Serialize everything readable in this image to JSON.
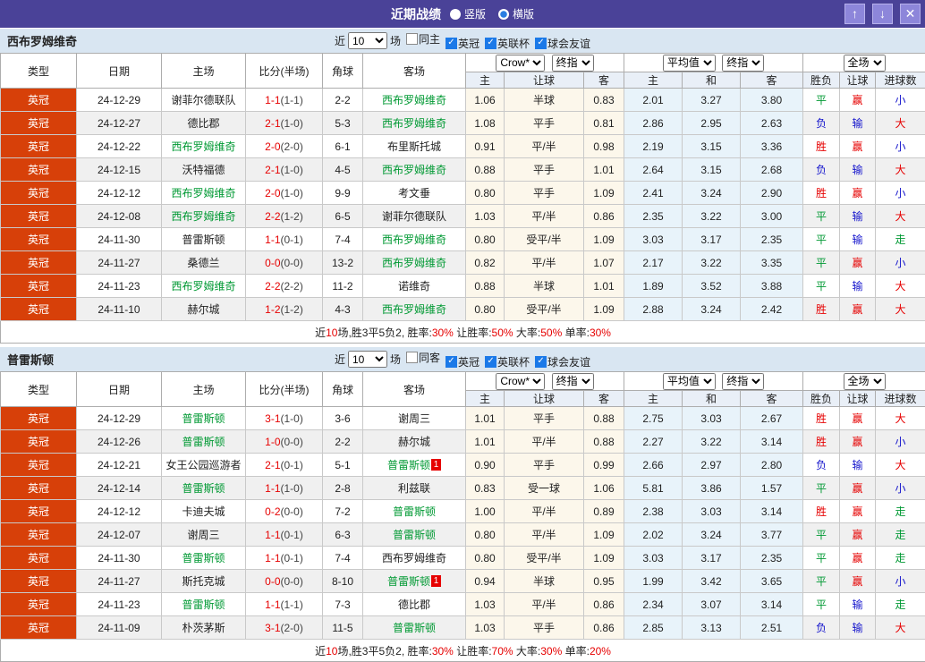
{
  "colors": {
    "titlebar_bg": "#4a4298",
    "section_header_bg": "#d9e6f2",
    "league_badge_bg": "#d74009",
    "win_red": "#e60000",
    "lose_blue": "#1414cc",
    "draw_green": "#009933",
    "team_highlight_green": "#009933",
    "asian_odds_bg": "#fcf7eb",
    "euro_odds_bg": "#e8f3fa"
  },
  "titlebar": {
    "title": "近期战绩",
    "radios": [
      {
        "label": "竖版",
        "state": "off"
      },
      {
        "label": "横版",
        "state": "on"
      }
    ],
    "up_button": "↑",
    "down_button": "↓",
    "close_button": "✕"
  },
  "table_header": {
    "left_columns": [
      "类型",
      "日期",
      "主场",
      "比分(半场)",
      "角球",
      "客场"
    ],
    "group1_selects": [
      "Crow*",
      "终指"
    ],
    "group2_selects": [
      "平均值",
      "终指"
    ],
    "group3_selects": [
      "全场"
    ],
    "sub_columns": [
      "主",
      "让球",
      "客",
      "主",
      "和",
      "客",
      "胜负",
      "让球",
      "进球数"
    ]
  },
  "sections": [
    {
      "team": "西布罗姆维奇",
      "filters": {
        "prefix": "近",
        "count": "10",
        "suffix": "场",
        "checks": [
          {
            "label": "同主",
            "state": "off"
          },
          {
            "label": "英冠",
            "state": "on"
          },
          {
            "label": "英联杯",
            "state": "on"
          },
          {
            "label": "球会友谊",
            "state": "on"
          }
        ]
      },
      "rows": [
        {
          "league": "英冠",
          "date": "24-12-29",
          "home": {
            "t": "谢菲尔德联队",
            "c": "k"
          },
          "ft": "1-1",
          "ht": "(1-1)",
          "corner": "2-2",
          "away": {
            "t": "西布罗姆维奇",
            "c": "g"
          },
          "badge": "",
          "ah": [
            "1.06",
            "半球",
            "0.83"
          ],
          "eu": [
            "2.01",
            "3.27",
            "3.80"
          ],
          "res": [
            {
              "t": "平",
              "c": "g"
            },
            {
              "t": "赢",
              "c": "r"
            },
            {
              "t": "小",
              "c": "b"
            }
          ]
        },
        {
          "league": "英冠",
          "date": "24-12-27",
          "home": {
            "t": "德比郡",
            "c": "k"
          },
          "ft": "2-1",
          "ht": "(1-0)",
          "corner": "5-3",
          "away": {
            "t": "西布罗姆维奇",
            "c": "g"
          },
          "badge": "",
          "ah": [
            "1.08",
            "平手",
            "0.81"
          ],
          "eu": [
            "2.86",
            "2.95",
            "2.63"
          ],
          "res": [
            {
              "t": "负",
              "c": "b"
            },
            {
              "t": "输",
              "c": "b"
            },
            {
              "t": "大",
              "c": "r"
            }
          ]
        },
        {
          "league": "英冠",
          "date": "24-12-22",
          "home": {
            "t": "西布罗姆维奇",
            "c": "g"
          },
          "ft": "2-0",
          "ht": "(2-0)",
          "corner": "6-1",
          "away": {
            "t": "布里斯托城",
            "c": "k"
          },
          "badge": "",
          "ah": [
            "0.91",
            "平/半",
            "0.98"
          ],
          "eu": [
            "2.19",
            "3.15",
            "3.36"
          ],
          "res": [
            {
              "t": "胜",
              "c": "r"
            },
            {
              "t": "赢",
              "c": "r"
            },
            {
              "t": "小",
              "c": "b"
            }
          ]
        },
        {
          "league": "英冠",
          "date": "24-12-15",
          "home": {
            "t": "沃特福德",
            "c": "k"
          },
          "ft": "2-1",
          "ht": "(1-0)",
          "corner": "4-5",
          "away": {
            "t": "西布罗姆维奇",
            "c": "g"
          },
          "badge": "",
          "ah": [
            "0.88",
            "平手",
            "1.01"
          ],
          "eu": [
            "2.64",
            "3.15",
            "2.68"
          ],
          "res": [
            {
              "t": "负",
              "c": "b"
            },
            {
              "t": "输",
              "c": "b"
            },
            {
              "t": "大",
              "c": "r"
            }
          ]
        },
        {
          "league": "英冠",
          "date": "24-12-12",
          "home": {
            "t": "西布罗姆维奇",
            "c": "g"
          },
          "ft": "2-0",
          "ht": "(1-0)",
          "corner": "9-9",
          "away": {
            "t": "考文垂",
            "c": "k"
          },
          "badge": "",
          "ah": [
            "0.80",
            "平手",
            "1.09"
          ],
          "eu": [
            "2.41",
            "3.24",
            "2.90"
          ],
          "res": [
            {
              "t": "胜",
              "c": "r"
            },
            {
              "t": "赢",
              "c": "r"
            },
            {
              "t": "小",
              "c": "b"
            }
          ]
        },
        {
          "league": "英冠",
          "date": "24-12-08",
          "home": {
            "t": "西布罗姆维奇",
            "c": "g"
          },
          "ft": "2-2",
          "ht": "(1-2)",
          "corner": "6-5",
          "away": {
            "t": "谢菲尔德联队",
            "c": "k"
          },
          "badge": "",
          "ah": [
            "1.03",
            "平/半",
            "0.86"
          ],
          "eu": [
            "2.35",
            "3.22",
            "3.00"
          ],
          "res": [
            {
              "t": "平",
              "c": "g"
            },
            {
              "t": "输",
              "c": "b"
            },
            {
              "t": "大",
              "c": "r"
            }
          ]
        },
        {
          "league": "英冠",
          "date": "24-11-30",
          "home": {
            "t": "普雷斯顿",
            "c": "k"
          },
          "ft": "1-1",
          "ht": "(0-1)",
          "corner": "7-4",
          "away": {
            "t": "西布罗姆维奇",
            "c": "g"
          },
          "badge": "",
          "ah": [
            "0.80",
            "受平/半",
            "1.09"
          ],
          "eu": [
            "3.03",
            "3.17",
            "2.35"
          ],
          "res": [
            {
              "t": "平",
              "c": "g"
            },
            {
              "t": "输",
              "c": "b"
            },
            {
              "t": "走",
              "c": "g"
            }
          ]
        },
        {
          "league": "英冠",
          "date": "24-11-27",
          "home": {
            "t": "桑德兰",
            "c": "k"
          },
          "ft": "0-0",
          "ht": "(0-0)",
          "corner": "13-2",
          "away": {
            "t": "西布罗姆维奇",
            "c": "g"
          },
          "badge": "",
          "ah": [
            "0.82",
            "平/半",
            "1.07"
          ],
          "eu": [
            "2.17",
            "3.22",
            "3.35"
          ],
          "res": [
            {
              "t": "平",
              "c": "g"
            },
            {
              "t": "赢",
              "c": "r"
            },
            {
              "t": "小",
              "c": "b"
            }
          ]
        },
        {
          "league": "英冠",
          "date": "24-11-23",
          "home": {
            "t": "西布罗姆维奇",
            "c": "g"
          },
          "ft": "2-2",
          "ht": "(2-2)",
          "corner": "11-2",
          "away": {
            "t": "诺维奇",
            "c": "k"
          },
          "badge": "",
          "ah": [
            "0.88",
            "半球",
            "1.01"
          ],
          "eu": [
            "1.89",
            "3.52",
            "3.88"
          ],
          "res": [
            {
              "t": "平",
              "c": "g"
            },
            {
              "t": "输",
              "c": "b"
            },
            {
              "t": "大",
              "c": "r"
            }
          ]
        },
        {
          "league": "英冠",
          "date": "24-11-10",
          "home": {
            "t": "赫尔城",
            "c": "k"
          },
          "ft": "1-2",
          "ht": "(1-2)",
          "corner": "4-3",
          "away": {
            "t": "西布罗姆维奇",
            "c": "g"
          },
          "badge": "",
          "ah": [
            "0.80",
            "受平/半",
            "1.09"
          ],
          "eu": [
            "2.88",
            "3.24",
            "2.42"
          ],
          "res": [
            {
              "t": "胜",
              "c": "r"
            },
            {
              "t": "赢",
              "c": "r"
            },
            {
              "t": "大",
              "c": "r"
            }
          ]
        }
      ],
      "summary": [
        {
          "t": "近",
          "c": "k"
        },
        {
          "t": "10",
          "c": "r"
        },
        {
          "t": "场,胜3平5负2, 胜率:",
          "c": "k"
        },
        {
          "t": "30%",
          "c": "r"
        },
        {
          "t": " 让胜率:",
          "c": "k"
        },
        {
          "t": "50%",
          "c": "r"
        },
        {
          "t": " 大率:",
          "c": "k"
        },
        {
          "t": "50%",
          "c": "r"
        },
        {
          "t": " 单率:",
          "c": "k"
        },
        {
          "t": "30%",
          "c": "r"
        }
      ]
    },
    {
      "team": "普雷斯顿",
      "filters": {
        "prefix": "近",
        "count": "10",
        "suffix": "场",
        "checks": [
          {
            "label": "同客",
            "state": "off"
          },
          {
            "label": "英冠",
            "state": "on"
          },
          {
            "label": "英联杯",
            "state": "on"
          },
          {
            "label": "球会友谊",
            "state": "on"
          }
        ]
      },
      "rows": [
        {
          "league": "英冠",
          "date": "24-12-29",
          "home": {
            "t": "普雷斯顿",
            "c": "g"
          },
          "ft": "3-1",
          "ht": "(1-0)",
          "corner": "3-6",
          "away": {
            "t": "谢周三",
            "c": "k"
          },
          "badge": "",
          "ah": [
            "1.01",
            "平手",
            "0.88"
          ],
          "eu": [
            "2.75",
            "3.03",
            "2.67"
          ],
          "res": [
            {
              "t": "胜",
              "c": "r"
            },
            {
              "t": "赢",
              "c": "r"
            },
            {
              "t": "大",
              "c": "r"
            }
          ]
        },
        {
          "league": "英冠",
          "date": "24-12-26",
          "home": {
            "t": "普雷斯顿",
            "c": "g"
          },
          "ft": "1-0",
          "ht": "(0-0)",
          "corner": "2-2",
          "away": {
            "t": "赫尔城",
            "c": "k"
          },
          "badge": "",
          "ah": [
            "1.01",
            "平/半",
            "0.88"
          ],
          "eu": [
            "2.27",
            "3.22",
            "3.14"
          ],
          "res": [
            {
              "t": "胜",
              "c": "r"
            },
            {
              "t": "赢",
              "c": "r"
            },
            {
              "t": "小",
              "c": "b"
            }
          ]
        },
        {
          "league": "英冠",
          "date": "24-12-21",
          "home": {
            "t": "女王公园巡游者",
            "c": "k"
          },
          "ft": "2-1",
          "ht": "(0-1)",
          "corner": "5-1",
          "away": {
            "t": "普雷斯顿",
            "c": "g"
          },
          "badge": "1",
          "ah": [
            "0.90",
            "平手",
            "0.99"
          ],
          "eu": [
            "2.66",
            "2.97",
            "2.80"
          ],
          "res": [
            {
              "t": "负",
              "c": "b"
            },
            {
              "t": "输",
              "c": "b"
            },
            {
              "t": "大",
              "c": "r"
            }
          ]
        },
        {
          "league": "英冠",
          "date": "24-12-14",
          "home": {
            "t": "普雷斯顿",
            "c": "g"
          },
          "ft": "1-1",
          "ht": "(1-0)",
          "corner": "2-8",
          "away": {
            "t": "利兹联",
            "c": "k"
          },
          "badge": "",
          "ah": [
            "0.83",
            "受一球",
            "1.06"
          ],
          "eu": [
            "5.81",
            "3.86",
            "1.57"
          ],
          "res": [
            {
              "t": "平",
              "c": "g"
            },
            {
              "t": "赢",
              "c": "r"
            },
            {
              "t": "小",
              "c": "b"
            }
          ]
        },
        {
          "league": "英冠",
          "date": "24-12-12",
          "home": {
            "t": "卡迪夫城",
            "c": "k"
          },
          "ft": "0-2",
          "ht": "(0-0)",
          "corner": "7-2",
          "away": {
            "t": "普雷斯顿",
            "c": "g"
          },
          "badge": "",
          "ah": [
            "1.00",
            "平/半",
            "0.89"
          ],
          "eu": [
            "2.38",
            "3.03",
            "3.14"
          ],
          "res": [
            {
              "t": "胜",
              "c": "r"
            },
            {
              "t": "赢",
              "c": "r"
            },
            {
              "t": "走",
              "c": "g"
            }
          ]
        },
        {
          "league": "英冠",
          "date": "24-12-07",
          "home": {
            "t": "谢周三",
            "c": "k"
          },
          "ft": "1-1",
          "ht": "(0-1)",
          "corner": "6-3",
          "away": {
            "t": "普雷斯顿",
            "c": "g"
          },
          "badge": "",
          "ah": [
            "0.80",
            "平/半",
            "1.09"
          ],
          "eu": [
            "2.02",
            "3.24",
            "3.77"
          ],
          "res": [
            {
              "t": "平",
              "c": "g"
            },
            {
              "t": "赢",
              "c": "r"
            },
            {
              "t": "走",
              "c": "g"
            }
          ]
        },
        {
          "league": "英冠",
          "date": "24-11-30",
          "home": {
            "t": "普雷斯顿",
            "c": "g"
          },
          "ft": "1-1",
          "ht": "(0-1)",
          "corner": "7-4",
          "away": {
            "t": "西布罗姆维奇",
            "c": "k"
          },
          "badge": "",
          "ah": [
            "0.80",
            "受平/半",
            "1.09"
          ],
          "eu": [
            "3.03",
            "3.17",
            "2.35"
          ],
          "res": [
            {
              "t": "平",
              "c": "g"
            },
            {
              "t": "赢",
              "c": "r"
            },
            {
              "t": "走",
              "c": "g"
            }
          ]
        },
        {
          "league": "英冠",
          "date": "24-11-27",
          "home": {
            "t": "斯托克城",
            "c": "k"
          },
          "ft": "0-0",
          "ht": "(0-0)",
          "corner": "8-10",
          "away": {
            "t": "普雷斯顿",
            "c": "g"
          },
          "badge": "1",
          "ah": [
            "0.94",
            "半球",
            "0.95"
          ],
          "eu": [
            "1.99",
            "3.42",
            "3.65"
          ],
          "res": [
            {
              "t": "平",
              "c": "g"
            },
            {
              "t": "赢",
              "c": "r"
            },
            {
              "t": "小",
              "c": "b"
            }
          ]
        },
        {
          "league": "英冠",
          "date": "24-11-23",
          "home": {
            "t": "普雷斯顿",
            "c": "g"
          },
          "ft": "1-1",
          "ht": "(1-1)",
          "corner": "7-3",
          "away": {
            "t": "德比郡",
            "c": "k"
          },
          "badge": "",
          "ah": [
            "1.03",
            "平/半",
            "0.86"
          ],
          "eu": [
            "2.34",
            "3.07",
            "3.14"
          ],
          "res": [
            {
              "t": "平",
              "c": "g"
            },
            {
              "t": "输",
              "c": "b"
            },
            {
              "t": "走",
              "c": "g"
            }
          ]
        },
        {
          "league": "英冠",
          "date": "24-11-09",
          "home": {
            "t": "朴茨茅斯",
            "c": "k"
          },
          "ft": "3-1",
          "ht": "(2-0)",
          "corner": "11-5",
          "away": {
            "t": "普雷斯顿",
            "c": "g"
          },
          "badge": "",
          "ah": [
            "1.03",
            "平手",
            "0.86"
          ],
          "eu": [
            "2.85",
            "3.13",
            "2.51"
          ],
          "res": [
            {
              "t": "负",
              "c": "b"
            },
            {
              "t": "输",
              "c": "b"
            },
            {
              "t": "大",
              "c": "r"
            }
          ]
        }
      ],
      "summary": [
        {
          "t": "近",
          "c": "k"
        },
        {
          "t": "10",
          "c": "r"
        },
        {
          "t": "场,胜3平5负2, 胜率:",
          "c": "k"
        },
        {
          "t": "30%",
          "c": "r"
        },
        {
          "t": " 让胜率:",
          "c": "k"
        },
        {
          "t": "70%",
          "c": "r"
        },
        {
          "t": " 大率:",
          "c": "k"
        },
        {
          "t": "30%",
          "c": "r"
        },
        {
          "t": " 单率:",
          "c": "k"
        },
        {
          "t": "20%",
          "c": "r"
        }
      ]
    }
  ]
}
